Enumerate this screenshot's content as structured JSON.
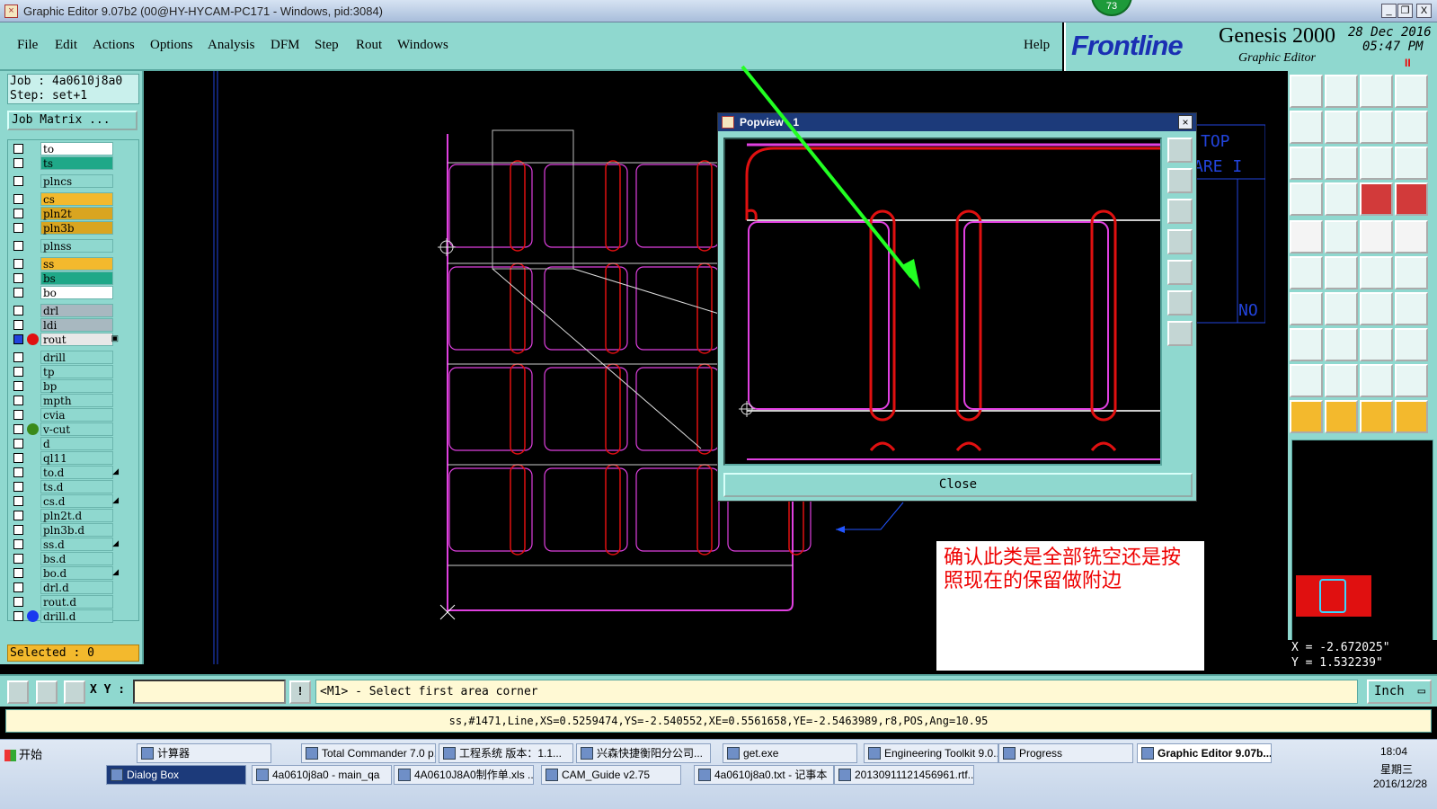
{
  "window": {
    "title": "Graphic Editor 9.07b2 (00@HY-HYCAM-PC171 - Windows, pid:3084)",
    "badge": "73",
    "buttons": [
      "_",
      "❐",
      "X"
    ]
  },
  "menu": {
    "items": [
      "File",
      "Edit",
      "Actions",
      "Options",
      "Analysis",
      "DFM",
      "Step",
      "Rout",
      "Windows"
    ],
    "help": "Help"
  },
  "brand": {
    "logo": "Frontline",
    "product": "Genesis 2000",
    "subtitle": "Graphic Editor",
    "date": "28 Dec 2016",
    "time": "05:47 PM",
    "pause": "II"
  },
  "job": {
    "job_line": "Job : 4a0610j8a0",
    "step_line": "Step: set+1",
    "matrix_button": "Job Matrix ..."
  },
  "layers": [
    {
      "name": "to",
      "color": "#ffffff",
      "dot": ""
    },
    {
      "name": "ts",
      "color": "#1fa888",
      "dot": ""
    },
    {
      "name": "plncs",
      "color": "#8fd8cf",
      "dot": ""
    },
    {
      "name": "cs",
      "color": "#f3b92d",
      "dot": ""
    },
    {
      "name": "pln2t",
      "color": "#d9a520",
      "dot": ""
    },
    {
      "name": "pln3b",
      "color": "#d9a520",
      "dot": ""
    },
    {
      "name": "plnss",
      "color": "#8fd8cf",
      "dot": ""
    },
    {
      "name": "ss",
      "color": "#f3b92d",
      "dot": ""
    },
    {
      "name": "bs",
      "color": "#1fa888",
      "dot": ""
    },
    {
      "name": "bo",
      "color": "#ffffff",
      "dot": ""
    },
    {
      "name": "drl",
      "color": "#a8b8c0",
      "dot": ""
    },
    {
      "name": "ldi",
      "color": "#a8b8c0",
      "dot": ""
    },
    {
      "name": "rout",
      "color": "#e8e8e8",
      "dot": "#e01010",
      "flag": "▣",
      "checked": true
    },
    {
      "name": "drill",
      "color": "#8fd8cf",
      "dot": ""
    },
    {
      "name": "tp",
      "color": "#8fd8cf",
      "dot": ""
    },
    {
      "name": "bp",
      "color": "#8fd8cf",
      "dot": ""
    },
    {
      "name": "mpth",
      "color": "#8fd8cf",
      "dot": ""
    },
    {
      "name": "cvia",
      "color": "#8fd8cf",
      "dot": ""
    },
    {
      "name": "v-cut",
      "color": "#8fd8cf",
      "dot": "#3a8a1a"
    },
    {
      "name": "d",
      "color": "#8fd8cf",
      "dot": ""
    },
    {
      "name": "ql11",
      "color": "#8fd8cf",
      "dot": ""
    },
    {
      "name": "to.d",
      "color": "#8fd8cf",
      "dot": "",
      "flag": "◢"
    },
    {
      "name": "ts.d",
      "color": "#8fd8cf",
      "dot": ""
    },
    {
      "name": "cs.d",
      "color": "#8fd8cf",
      "dot": "",
      "flag": "◢"
    },
    {
      "name": "pln2t.d",
      "color": "#8fd8cf",
      "dot": ""
    },
    {
      "name": "pln3b.d",
      "color": "#8fd8cf",
      "dot": ""
    },
    {
      "name": "ss.d",
      "color": "#8fd8cf",
      "dot": "",
      "flag": "◢"
    },
    {
      "name": "bs.d",
      "color": "#8fd8cf",
      "dot": ""
    },
    {
      "name": "bo.d",
      "color": "#8fd8cf",
      "dot": "",
      "flag": "◢"
    },
    {
      "name": "drl.d",
      "color": "#8fd8cf",
      "dot": ""
    },
    {
      "name": "rout.d",
      "color": "#8fd8cf",
      "dot": ""
    },
    {
      "name": "drill.d",
      "color": "#8fd8cf",
      "dot": "#1a3af0"
    }
  ],
  "selected": "Selected : 0",
  "popview": {
    "title": "Popview - 1",
    "close_button": "Close"
  },
  "canvas_text": {
    "top_label": "TOP",
    "are_label": "ARE I",
    "no_label": "NO"
  },
  "note": "确认此类是全部铣空还是按照现在的保留做附边",
  "coordinates": {
    "x": "X = -2.672025\"",
    "y": "Y = 1.532239\""
  },
  "command": {
    "xy_label": "X Y :",
    "xy_value": "",
    "bang": "!",
    "message": "<M1> - Select first area corner",
    "units": "Inch"
  },
  "status_line": "ss,#1471,Line,XS=0.5259474,YS=-2.540552,XE=0.5561658,YE=-2.5463989,r8,POS,Ang=10.95",
  "taskbar": {
    "start": "开始",
    "row1": [
      "计算器",
      "Total Commander 7.0 p...",
      "工程系统  版本：1.1...",
      "兴森快捷衡阳分公司...",
      "get.exe",
      "Engineering Toolkit 9.0...",
      "Progress",
      "Graphic Editor 9.07b..."
    ],
    "row2": [
      "Dialog Box",
      "4a0610j8a0 - main_qa",
      "4A0610J8A0制作单.xls ...",
      "CAM_Guide v2.75",
      "4a0610j8a0.txt - 记事本",
      "20130911121456961.rtf..."
    ],
    "clock_time": "18:04",
    "clock_day": "星期三",
    "clock_date": "2016/12/28"
  }
}
